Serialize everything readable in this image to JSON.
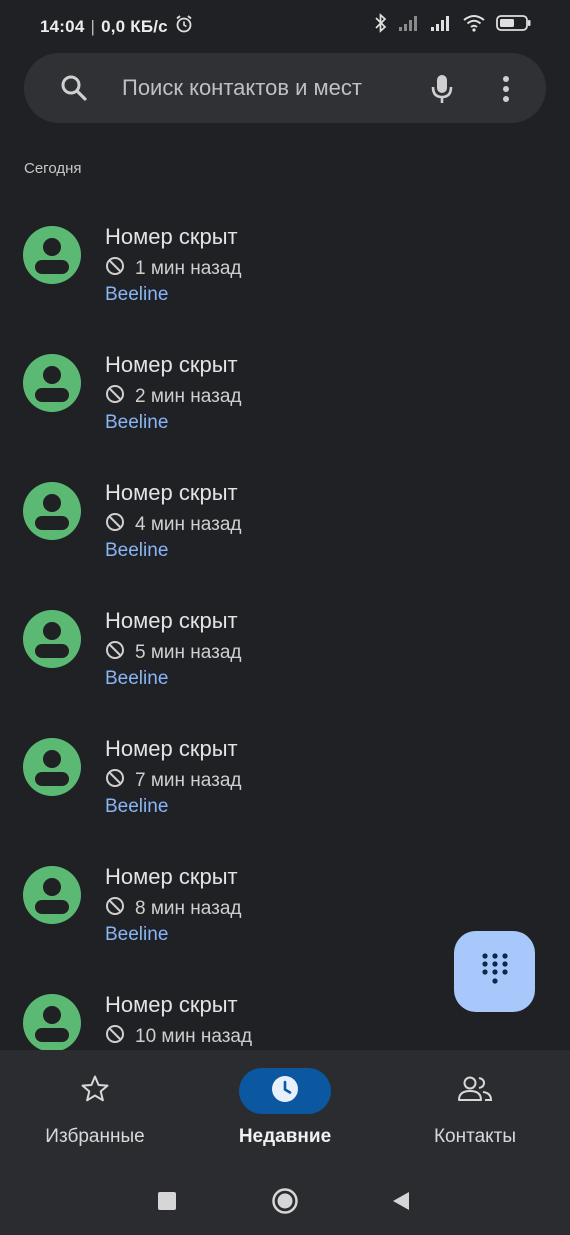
{
  "status_bar": {
    "time": "14:04",
    "separator": "|",
    "net_speed": "0,0 КБ/с"
  },
  "search": {
    "placeholder": "Поиск контактов и мест"
  },
  "section": {
    "title": "Сегодня"
  },
  "calls": [
    {
      "name": "Номер скрыт",
      "time": "1 мин назад",
      "carrier": "Beeline"
    },
    {
      "name": "Номер скрыт",
      "time": "2 мин назад",
      "carrier": "Beeline"
    },
    {
      "name": "Номер скрыт",
      "time": "4 мин назад",
      "carrier": "Beeline"
    },
    {
      "name": "Номер скрыт",
      "time": "5 мин назад",
      "carrier": "Beeline"
    },
    {
      "name": "Номер скрыт",
      "time": "7 мин назад",
      "carrier": "Beeline"
    },
    {
      "name": "Номер скрыт",
      "time": "8 мин назад",
      "carrier": "Beeline"
    },
    {
      "name": "Номер скрыт",
      "time": "10 мин назад",
      "carrier": ""
    }
  ],
  "bottom_nav": {
    "favorites": "Избранные",
    "recents": "Недавние",
    "contacts": "Контакты",
    "active": "recents"
  },
  "icons": {
    "status": [
      "alarm-icon",
      "bluetooth-icon",
      "signal-icon",
      "signal-icon",
      "wifi-icon",
      "battery-icon"
    ],
    "search": "search-icon",
    "mic": "mic-icon",
    "more": "more-vert-icon",
    "blocked": "blocked-icon",
    "fab": "dialpad-icon"
  },
  "colors": {
    "background": "#202124",
    "avatar": "#5bb974",
    "carrier": "#8ab4f8",
    "fab": "#a8c7fa",
    "active_nav": "#0b57a0"
  }
}
